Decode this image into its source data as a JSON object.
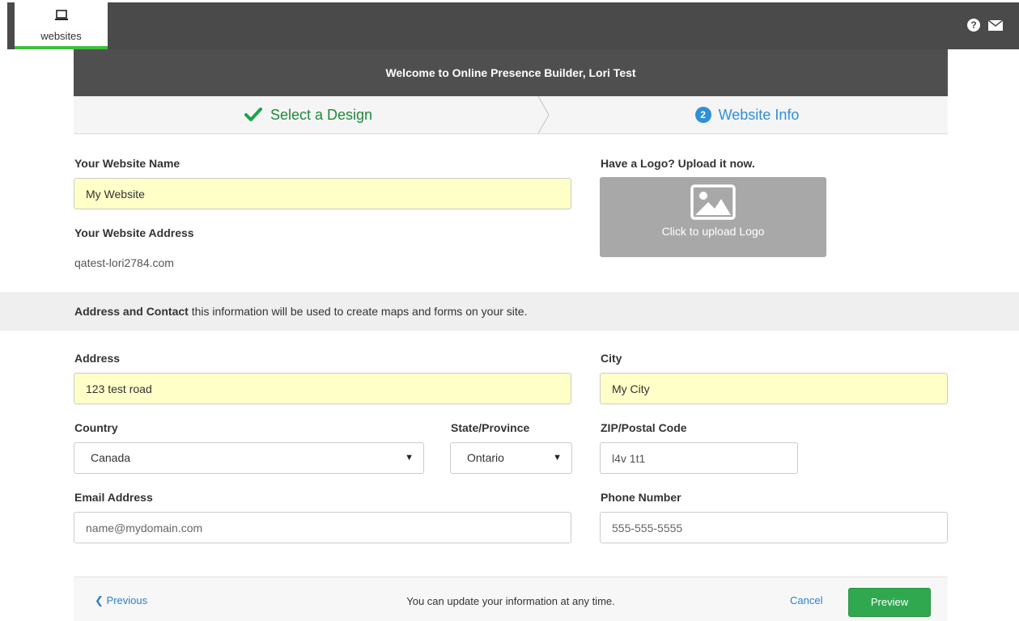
{
  "topbar": {
    "tab_label": "websites",
    "icons": [
      "laptop-icon",
      "help-icon",
      "mail-icon"
    ],
    "help_glyph": "?"
  },
  "welcome": "Welcome to Online Presence Builder, Lori Test",
  "steps": {
    "step1": "Select a Design",
    "step2_number": "2",
    "step2": "Website Info"
  },
  "site": {
    "name_label": "Your Website Name",
    "name_value": "My Website",
    "address_label": "Your Website Address",
    "address_value": "qatest-lori2784.com",
    "logo_label": "Have a Logo? Upload it now.",
    "logo_button": "Click to upload Logo"
  },
  "contact_section": {
    "title": "Address and Contact",
    "description": " this information will be used to create maps and forms on your site."
  },
  "form": {
    "address_label": "Address",
    "address_value": "123 test road",
    "city_label": "City",
    "city_value": "My City",
    "country_label": "Country",
    "country_value": "Canada",
    "state_label": "State/Province",
    "state_value": "Ontario",
    "zip_label": "ZIP/Postal Code",
    "zip_value": "l4v 1t1",
    "email_label": "Email Address",
    "email_placeholder": "name@mydomain.com",
    "phone_label": "Phone Number",
    "phone_placeholder": "555-555-5555"
  },
  "footer": {
    "previous": "Previous",
    "note": "You can update your information at any time.",
    "cancel": "Cancel",
    "preview": "Preview"
  },
  "colors": {
    "accent_green": "#3ec03e",
    "step_blue": "#2f8fd8",
    "filled_field": "#ffffc8",
    "preview_green": "#2fa84f"
  }
}
